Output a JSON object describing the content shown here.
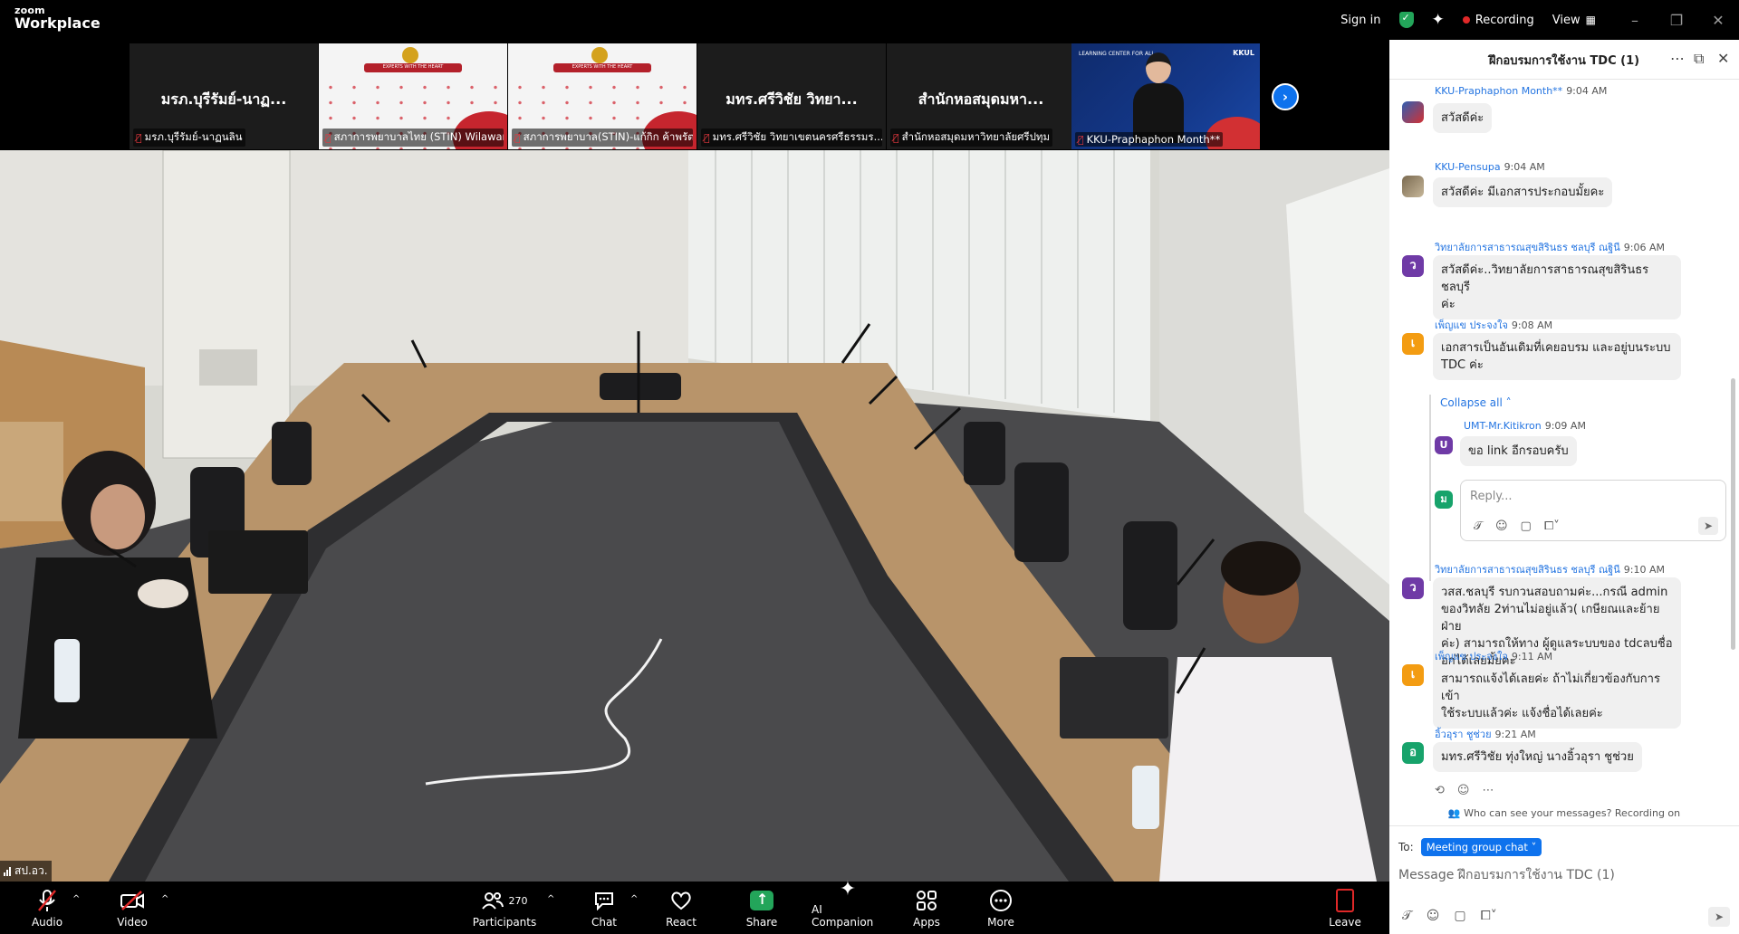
{
  "app": {
    "brand_small": "zoom",
    "brand_large": "Workplace"
  },
  "topbar": {
    "sign_in": "Sign in",
    "recording": "Recording",
    "view": "View"
  },
  "thumbnails": [
    {
      "center_name": "มรภ.บุรีรัมย์-นาฏ...",
      "label": "มรภ.บุรีรัมย์-นาฏนลิน",
      "kind": "name"
    },
    {
      "center_name": "",
      "label": "สภาการพยาบาลไทย (STIN) Wilawan ...",
      "kind": "slide"
    },
    {
      "center_name": "",
      "label": "สภาการพยาบาล(STIN)-แก้กิก ค้าพรัต",
      "kind": "slide"
    },
    {
      "center_name": "มทร.ศรีวิชัย วิทยา...",
      "label": "มทร.ศรีวิชัย วิทยาเขตนครศรีธรรมร...",
      "kind": "name"
    },
    {
      "center_name": "สำนักหอสมุดมหา...",
      "label": "สำนักหอสมุดมหาวิทยาลัยศรีปทุม",
      "kind": "name"
    },
    {
      "center_name": "",
      "label": "KKU-Praphaphon Month**",
      "kind": "kku"
    }
  ],
  "thumbnail_slide_text": "EXPERTS WITH THE HEART",
  "thumbnail_kku_text": {
    "left": "LEARNING CENTER FOR ALL",
    "right": "KKUL"
  },
  "main_video": {
    "name_tag": "สป.อว."
  },
  "toolbar": {
    "audio": "Audio",
    "video": "Video",
    "participants": "Participants",
    "participants_count": "270",
    "chat": "Chat",
    "react": "React",
    "share": "Share",
    "ai_companion": "AI Companion",
    "apps": "Apps",
    "more": "More",
    "leave": "Leave"
  },
  "chat": {
    "title": "ฝึกอบรมการใช้งาน TDC (1)",
    "messages": [
      {
        "sender": "KKU-Praphaphon Month**",
        "time": "9:04 AM",
        "text": "สวัสดีค่ะ",
        "avatar": ""
      },
      {
        "sender": "KKU-Pensupa",
        "time": "9:04 AM",
        "text": "สวัสดีค่ะ มีเอกสารประกอบมั้ยคะ",
        "avatar": ""
      },
      {
        "sender": "วิทยาลัยการสาธารณสุขสิรินธร ชลบุรี ณฐินี",
        "time": "9:06 AM",
        "text_lines": [
          "สวัสดีค่ะ..วิทยาลัยการสาธารณสุขสิรินธร ชลบุรี",
          "ค่ะ"
        ],
        "avatar": "ว"
      },
      {
        "sender": "เพ็ญแข ประจงใจ",
        "time": "9:08 AM",
        "text_lines": [
          "เอกสารเป็นอันเดิมที่เคยอบรม  และอยู่บนระบบ",
          "TDC ค่ะ"
        ],
        "avatar": "เ"
      }
    ],
    "collapse_label": "Collapse all",
    "thread_reply": {
      "sender": "UMT-Mr.Kitikron",
      "time": "9:09 AM",
      "text": "ขอ link อีกรอบครับ",
      "avatar": "U"
    },
    "reply_avatar": "ม",
    "reply_placeholder": "Reply...",
    "later_messages": [
      {
        "sender": "วิทยาลัยการสาธารณสุขสิรินธร ชลบุรี ณฐินี",
        "time": "9:10 AM",
        "text_lines": [
          "วสส.ชลบุรี รบกวนสอบถามค่ะ...กรณี admin",
          "ของวิทลัย 2ท่านไม่อยู่แล้ว( เกษียณและย้ายฝ่าย",
          "ค่ะ) สามารถให้ทาง ผู้ดูแลระบบของ tdcลบชื่อ",
          "อกได้เลยมั้ยคะ"
        ],
        "avatar": "ว"
      },
      {
        "sender": "เพ็ญแข ประจงใจ",
        "time": "9:11 AM",
        "text_lines": [
          "สามารถแจ้งได้เลยค่ะ ถ้าไม่เกี่ยวข้องกับการเข้า",
          "ใช้ระบบแล้วค่ะ  แจ้งชื่อได้เลยค่ะ"
        ],
        "avatar": "เ"
      },
      {
        "sender": "อิ้วอุรา  ชูช่วย",
        "time": "9:21 AM",
        "text": "มทร.ศรีวิชัย ทุ่งใหญ่ นางอิ้วอุรา  ชูช่วย",
        "avatar": "อ"
      }
    ],
    "notice": "Who can see your messages? Recording on",
    "to_label": "To:",
    "to_target": "Meeting group chat",
    "compose_placeholder": "Message ฝึกอบรมการใช้งาน TDC (1)"
  },
  "colors": {
    "accent": "#0e72ed",
    "recording": "#e02828",
    "share": "#23a55a",
    "sender_link": "#2374e1"
  }
}
